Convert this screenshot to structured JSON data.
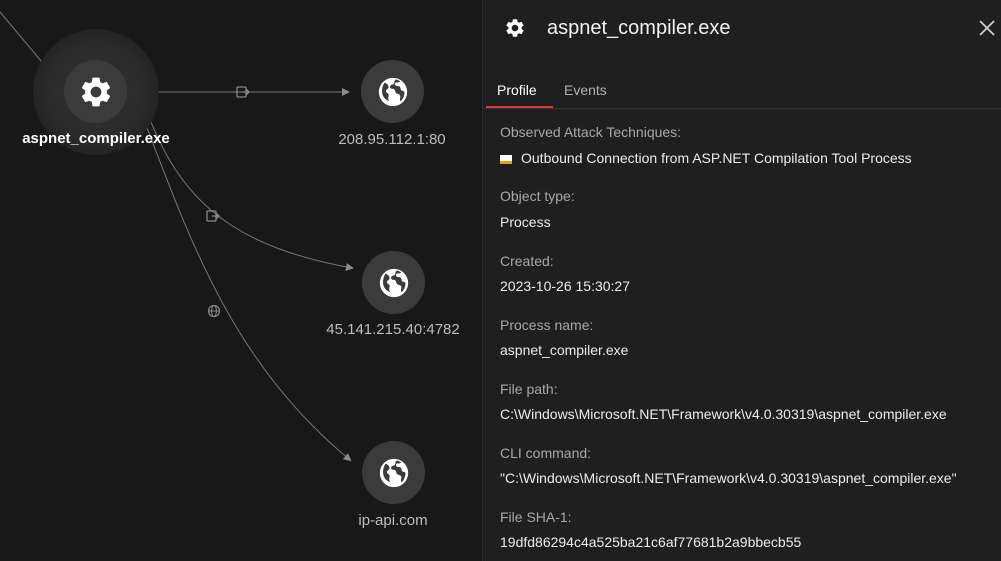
{
  "graph": {
    "nodes": [
      {
        "id": "process",
        "label": "aspnet_compiler.exe",
        "icon": "gear-icon"
      },
      {
        "id": "ip1",
        "label": "208.95.112.1:80",
        "icon": "globe-icon"
      },
      {
        "id": "ip2",
        "label": "45.141.215.40:4782",
        "icon": "globe-icon"
      },
      {
        "id": "host",
        "label": "ip-api.com",
        "icon": "globe-icon"
      }
    ],
    "edge_icons": [
      "connect-icon",
      "connect-icon",
      "dns-icon"
    ]
  },
  "panel": {
    "icon": "gear-icon",
    "title": "aspnet_compiler.exe",
    "tabs": [
      {
        "label": "Profile",
        "active": true
      },
      {
        "label": "Events",
        "active": false
      }
    ],
    "fields": [
      {
        "label": "Observed Attack Techniques:",
        "value": "Outbound Connection from ASP.NET Compilation Tool Process",
        "marker": true
      },
      {
        "label": "Object type:",
        "value": "Process"
      },
      {
        "label": "Created:",
        "value": "2023-10-26 15:30:27"
      },
      {
        "label": "Process name:",
        "value": "aspnet_compiler.exe"
      },
      {
        "label": "File path:",
        "value": "C:\\Windows\\Microsoft.NET\\Framework\\v4.0.30319\\aspnet_compiler.exe"
      },
      {
        "label": "CLI command:",
        "value": "\"C:\\Windows\\Microsoft.NET\\Framework\\v4.0.30319\\aspnet_compiler.exe\""
      },
      {
        "label": "File SHA-1:",
        "value": "19dfd86294c4a525ba21c6af77681b2a9bbecb55"
      }
    ]
  },
  "colors": {
    "accent": "#d9363e",
    "severity": "#e0a11b",
    "node_bg": "#3b3b3b"
  }
}
